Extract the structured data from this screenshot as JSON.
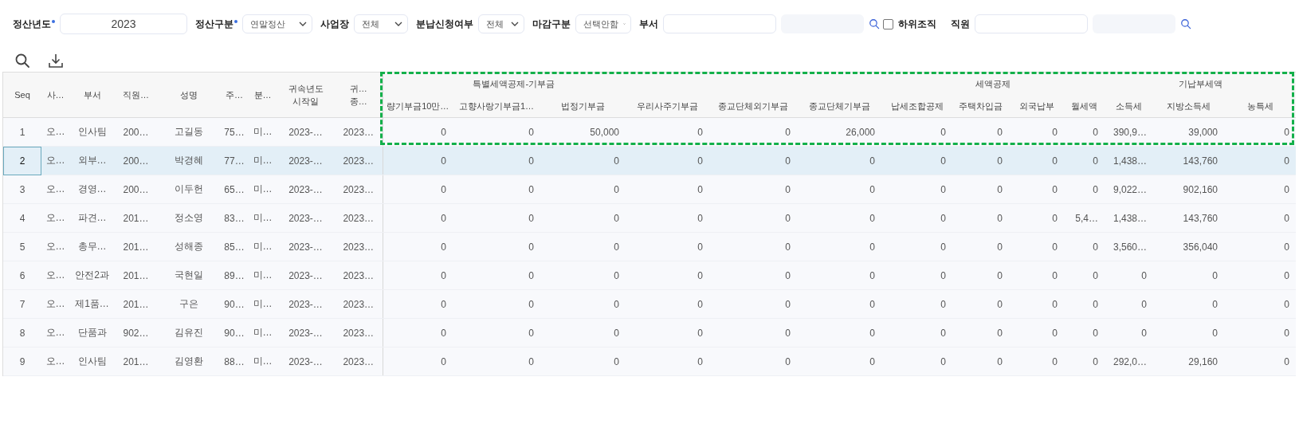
{
  "filters": [
    {
      "kind": "text",
      "label": "정산년도",
      "required": true,
      "value": "2023"
    },
    {
      "kind": "select",
      "label": "정산구분",
      "required": true,
      "value": "연말정산"
    },
    {
      "kind": "select",
      "label": "사업장",
      "required": false,
      "value": "전체"
    },
    {
      "kind": "select",
      "label": "분납신청여부",
      "required": false,
      "value": "전체"
    },
    {
      "kind": "select",
      "label": "마감구분",
      "required": false,
      "value": "선택안함"
    },
    {
      "kind": "lookup",
      "label": "부서",
      "required": false
    },
    {
      "kind": "checkbox",
      "label": "하위조직",
      "checked": false
    },
    {
      "kind": "lookup",
      "label": "직원",
      "required": false
    }
  ],
  "table": {
    "column_groups": [
      "특별세액공제-기부금",
      "세액공제",
      "기납부세액"
    ],
    "columns": [
      "Seq",
      "사…",
      "부서",
      "직원…",
      "성명",
      "주…",
      "분…",
      "귀속년도\n시작일",
      "귀…\n종…",
      "량기부금10만…",
      "고향사랑기부금1…",
      "법정기부금",
      "우리사주기부금",
      "종교단체외기부금",
      "종교단체기부금",
      "납세조합공제",
      "주택차입금",
      "외국납부",
      "월세액",
      "소득세",
      "지방소득세",
      "농특세"
    ],
    "rows": [
      {
        "selected": false,
        "cells": [
          "1",
          "오…",
          "인사팀",
          "200…",
          "고길동",
          "75…",
          "미…",
          "2023-…",
          "2023…",
          "0",
          "0",
          "50,000",
          "0",
          "0",
          "26,000",
          "0",
          "0",
          "0",
          "0",
          "390,9…",
          "39,000",
          "0"
        ]
      },
      {
        "selected": true,
        "cells": [
          "2",
          "오…",
          "외부…",
          "200…",
          "박경혜",
          "77…",
          "미…",
          "2023-…",
          "2023…",
          "0",
          "0",
          "0",
          "0",
          "0",
          "0",
          "0",
          "0",
          "0",
          "0",
          "1,438…",
          "143,760",
          "0"
        ]
      },
      {
        "selected": false,
        "cells": [
          "3",
          "오…",
          "경영…",
          "200…",
          "이두헌",
          "65…",
          "미…",
          "2023-…",
          "2023…",
          "0",
          "0",
          "0",
          "0",
          "0",
          "0",
          "0",
          "0",
          "0",
          "0",
          "9,022…",
          "902,160",
          "0"
        ]
      },
      {
        "selected": false,
        "cells": [
          "4",
          "오…",
          "파견…",
          "201…",
          "정소영",
          "83…",
          "미…",
          "2023-…",
          "2023…",
          "0",
          "0",
          "0",
          "0",
          "0",
          "0",
          "0",
          "0",
          "0",
          "5,4…",
          "1,438…",
          "143,760",
          "0"
        ]
      },
      {
        "selected": false,
        "cells": [
          "5",
          "오…",
          "총무…",
          "201…",
          "성해종",
          "85…",
          "미…",
          "2023-…",
          "2023…",
          "0",
          "0",
          "0",
          "0",
          "0",
          "0",
          "0",
          "0",
          "0",
          "0",
          "3,560…",
          "356,040",
          "0"
        ]
      },
      {
        "selected": false,
        "cells": [
          "6",
          "오…",
          "안전2과",
          "201…",
          "국현일",
          "89…",
          "미…",
          "2023-…",
          "2023…",
          "0",
          "0",
          "0",
          "0",
          "0",
          "0",
          "0",
          "0",
          "0",
          "0",
          "0",
          "0",
          "0"
        ]
      },
      {
        "selected": false,
        "cells": [
          "7",
          "오…",
          "제1품…",
          "201…",
          "구은",
          "90…",
          "미…",
          "2023-…",
          "2023…",
          "0",
          "0",
          "0",
          "0",
          "0",
          "0",
          "0",
          "0",
          "0",
          "0",
          "0",
          "0",
          "0"
        ]
      },
      {
        "selected": false,
        "cells": [
          "8",
          "오…",
          "단품과",
          "902…",
          "김유진",
          "90…",
          "미…",
          "2023-…",
          "2023…",
          "0",
          "0",
          "0",
          "0",
          "0",
          "0",
          "0",
          "0",
          "0",
          "0",
          "0",
          "0",
          "0"
        ]
      },
      {
        "selected": false,
        "cells": [
          "9",
          "오…",
          "인사팀",
          "201…",
          "김영환",
          "88…",
          "미…",
          "2023-…",
          "2023…",
          "0",
          "0",
          "0",
          "0",
          "0",
          "0",
          "0",
          "0",
          "0",
          "0",
          "292,0…",
          "29,160",
          "0"
        ]
      }
    ]
  }
}
